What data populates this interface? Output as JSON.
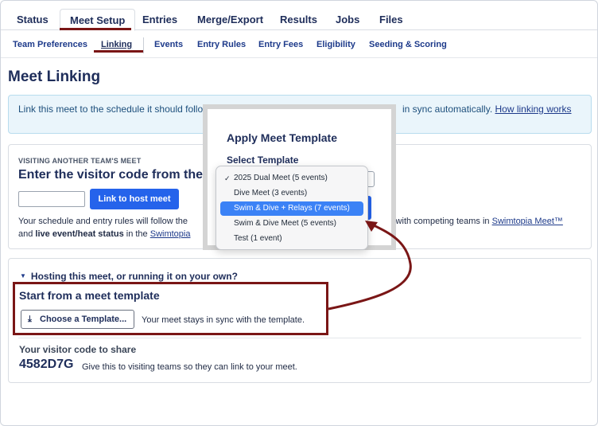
{
  "top_tabs": [
    {
      "label": "Status"
    },
    {
      "label": "Meet Setup"
    },
    {
      "label": "Entries"
    },
    {
      "label": "Merge/Export"
    },
    {
      "label": "Results"
    },
    {
      "label": "Jobs"
    },
    {
      "label": "Files"
    }
  ],
  "sub_tabs": [
    {
      "label": "Team Preferences"
    },
    {
      "label": "Linking"
    },
    {
      "label": "Events"
    },
    {
      "label": "Entry Rules"
    },
    {
      "label": "Entry Fees"
    },
    {
      "label": "Eligibility"
    },
    {
      "label": "Seeding & Scoring"
    }
  ],
  "page_title": "Meet Linking",
  "info": {
    "text": "Link this meet to the schedule it should follow",
    "text_right": "in sync automatically.",
    "link": "How linking works"
  },
  "visitor_card": {
    "eyebrow": "VISITING ANOTHER TEAM'S MEET",
    "heading": "Enter the visitor code from the ho",
    "input_value": "",
    "link_button": "Link to host meet",
    "desc_left_1": "Your schedule and entry rules will follow the",
    "desc_left_2_a": "and ",
    "desc_left_2_bold": "live event/heat status",
    "desc_left_2_b": " in the ",
    "desc_left_2_link": "Swimtopia",
    "desc_right_a": "s with competing teams in ",
    "desc_right_link": "Swimtopia Meet™"
  },
  "host_card": {
    "hosting_label": "Hosting this meet, or running it on your own?",
    "template_heading": "Start from a meet template",
    "choose_button": "Choose a Template...",
    "template_note": "Your meet stays in sync with the template.",
    "share_label": "Your visitor code to share",
    "share_code": "4582D7G",
    "share_desc": "Give this to visiting teams so they can link to your meet."
  },
  "modal": {
    "title": "Apply Meet Template",
    "select_label": "Select Template",
    "options": [
      {
        "label": "2025 Dual Meet (5 events)",
        "checked": true,
        "highlighted": false
      },
      {
        "label": "Dive Meet (3 events)",
        "checked": false,
        "highlighted": false
      },
      {
        "label": "Swim & Dive + Relays (7 events)",
        "checked": false,
        "highlighted": true
      },
      {
        "label": "Swim & Dive Meet (5 events)",
        "checked": false,
        "highlighted": false
      },
      {
        "label": "Test (1 event)",
        "checked": false,
        "highlighted": false
      }
    ]
  },
  "colors": {
    "annotation": "#7a1616",
    "primary": "#2563eb",
    "heading": "#1e2d5a"
  }
}
